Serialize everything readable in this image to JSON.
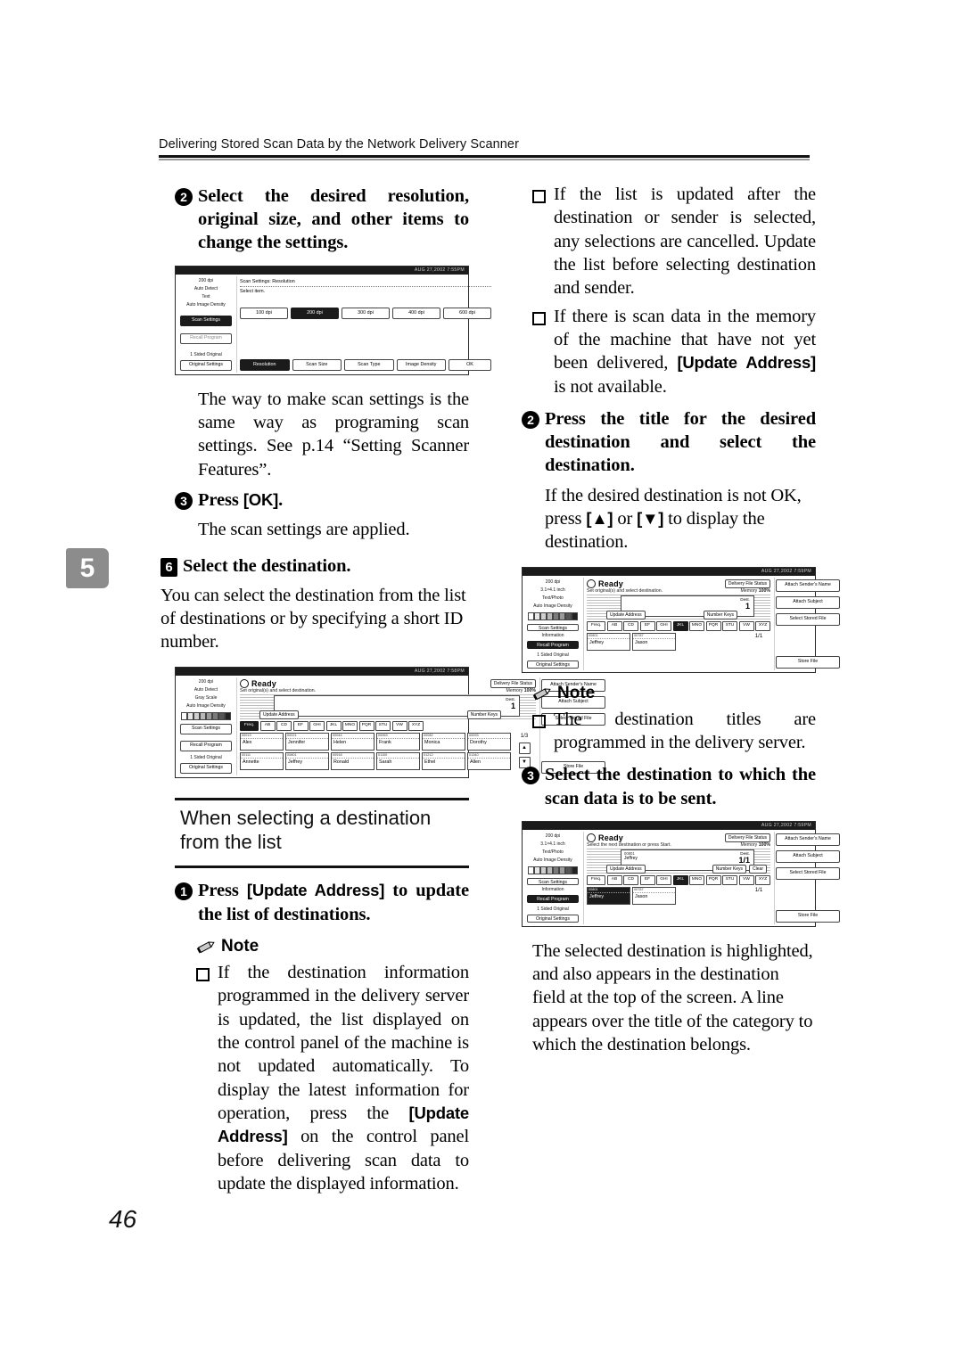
{
  "header": {
    "running_head": "Delivering Stored Scan Data by the Network Delivery Scanner"
  },
  "chapter_tab": "5",
  "folio": "46",
  "left_column": {
    "step2": {
      "num": "2",
      "text": "Select the desired resolution, original size, and other items to change the settings."
    },
    "para_scan_settings": "The way to make scan settings is the same way as programing scan settings. See p.14 “Setting Scanner Features”.",
    "step3": {
      "num": "3",
      "text_prefix": "Press ",
      "key": "[OK]",
      "text_suffix": "."
    },
    "para_applied": "The scan settings are applied.",
    "step6": {
      "num": "6",
      "text": "Select the destination."
    },
    "para_select_dest": "You can select the destination from the list of destinations or by specifying a short ID number.",
    "section_heading": "When selecting a destination from the list",
    "step1": {
      "num": "1",
      "text_prefix": "Press ",
      "key": "[Update Address]",
      "text_suffix": " to update the list of destinations."
    },
    "note_label": "Note",
    "note_bullet_1_part1": "If the destination information programmed in the delivery server is updated, the list displayed on the control panel of the machine is not updated automatically. To display the latest information for operation, press the ",
    "note_bullet_1_key": "[Update Address]",
    "note_bullet_1_part2": " on the control panel before delivering scan data to update the displayed information."
  },
  "right_column": {
    "note_bullet_1": "If the list is updated after the destination or sender is selected, any selections are cancelled. Update the list before selecting destination and sender.",
    "note_bullet_2_part1": "If there is scan data in the memory of the machine that have not yet been delivered, ",
    "note_bullet_2_key": "[Update Address]",
    "note_bullet_2_part2": " is not available.",
    "step2": {
      "num": "2",
      "text": "Press the title for the desired destination and select the destination."
    },
    "para_not_ok_part1": "If the desired destination is not OK, press ",
    "para_not_ok_key_up": "[▲]",
    "para_not_ok_mid": " or ",
    "para_not_ok_key_down": "[▼]",
    "para_not_ok_part2": " to display the destination.",
    "note_label": "Note",
    "note_bullet_3": "The destination titles are programmed in the delivery server.",
    "step3": {
      "num": "3",
      "text": "Select the destination to which the scan data is to be sent."
    },
    "para_highlighted": "The selected destination is highlighted, and also appears in the destination field at the top of the screen. A line appears over the title of the category to which the destination belongs."
  },
  "lcd_resolution": {
    "datetime": "AUG 27,2002 7:55PM",
    "sidebar": {
      "lines": [
        "200 dpi",
        "Auto Detect",
        "Text",
        "Auto Image Density"
      ],
      "scan_settings": "Scan Settings",
      "recall_program": "Recall Program",
      "sided": "1 Sided Original",
      "original_settings": "Original Settings"
    },
    "breadcrumb": "Scan Settings: Resolution",
    "prompt": "Select item.",
    "resolutions": [
      "100 dpi",
      "200 dpi",
      "300 dpi",
      "400 dpi",
      "600 dpi"
    ],
    "resolution_selected": "200 dpi",
    "bottom_tabs": [
      "Resolution",
      "Scan Size",
      "Scan Type",
      "Image Density"
    ],
    "bottom_tab_selected": "Resolution",
    "ok_label": "OK"
  },
  "lcd_list": {
    "datetime": "AUG 27,2002 7:58PM",
    "sidebar": {
      "lines": [
        "200 dpi",
        "Auto Detect",
        "Gray Scale",
        "Auto Image Density"
      ],
      "scan_settings": "Scan Settings",
      "recall_program": "Recall Program",
      "sided": "1 Sided Original",
      "original_settings": "Original Settings"
    },
    "status": "Ready",
    "subtitle": "Set original(s) and select destination.",
    "delivery_file_status": "Delivery File Status",
    "memory_label": "Memory",
    "memory_value": "100%",
    "dest_label": "Dest.",
    "dest_count": "1",
    "update_address": "Update Address",
    "number_keys": "Number Keys",
    "tabs": [
      "Freq.",
      "AB",
      "CD",
      "EF",
      "GHI",
      "JKL",
      "MNO",
      "PQR",
      "STU",
      "VW",
      "XYZ"
    ],
    "tab_selected": "Freq.",
    "page_indicator": "1/3",
    "entries_row1": [
      {
        "code": "00013",
        "name": "Alex"
      },
      {
        "code": "00021",
        "name": "Jennifer"
      },
      {
        "code": "00044",
        "name": "Helen"
      },
      {
        "code": "00063",
        "name": "Frank"
      },
      {
        "code": "00082",
        "name": "Monica"
      },
      {
        "code": "00093",
        "name": "Dorothy"
      }
    ],
    "entries_row2": [
      {
        "code": "00111",
        "name": "Annette"
      },
      {
        "code": "00801",
        "name": "Jeffrey"
      },
      {
        "code": "00918",
        "name": "Ronald"
      },
      {
        "code": "01100",
        "name": "Sarah"
      },
      {
        "code": "01212",
        "name": "Ethel"
      },
      {
        "code": "01340",
        "name": "Allen"
      }
    ],
    "right_buttons": [
      "Attach Sender's Name",
      "Attach Subject",
      "Select Stored File",
      "Store File"
    ]
  },
  "lcd_title": {
    "datetime": "AUG 27,2002 7:59PM",
    "sidebar": {
      "lines": [
        "200 dpi",
        "3.1×4.1 inch",
        "Text/Photo",
        "Auto Image Density"
      ],
      "scan_settings": "Scan Settings",
      "information": "Information",
      "recall_program": "Recall Program",
      "sided": "1 Sided Original",
      "original_settings": "Original Settings"
    },
    "status": "Ready",
    "subtitle": "Set original(s) and select destination.",
    "delivery_file_status": "Delivery File Status",
    "memory_label": "Memory",
    "memory_value": "100%",
    "dest_label": "Dest.",
    "dest_count": "1",
    "update_address": "Update Address",
    "number_keys": "Number Keys",
    "tabs": [
      "Freq.",
      "AB",
      "CD",
      "EF",
      "GHI",
      "JKL",
      "MNO",
      "PQR",
      "STU",
      "VW",
      "XYZ"
    ],
    "tab_selected": "JKL",
    "page_indicator": "1/1",
    "entries_row1": [
      {
        "code": "00801",
        "name": "Jeffrey"
      },
      {
        "code": "00787",
        "name": "Jason"
      }
    ],
    "right_buttons": [
      "Attach Sender's Name",
      "Attach Subject",
      "Select Stored File",
      "Store File"
    ]
  },
  "lcd_selected": {
    "datetime": "AUG 27,2002 7:59PM",
    "sidebar": {
      "lines": [
        "200 dpi",
        "3.1×4.1 inch",
        "Text/Photo",
        "Auto Image Density"
      ],
      "scan_settings": "Scan Settings",
      "information": "Information",
      "recall_program": "Recall Program",
      "sided": "1 Sided Original",
      "original_settings": "Original Settings"
    },
    "status": "Ready",
    "subtitle": "Select the next destination or press Start.",
    "delivery_file_status": "Delivery File Status",
    "memory_label": "Memory",
    "memory_value": "100%",
    "dest_label": "Dest.",
    "dest_count": "1/1",
    "dest_entry_code": "00801",
    "dest_entry_name": "Jeffrey",
    "update_address": "Update Address",
    "number_keys": "Number Keys",
    "clear_label": "Clear",
    "tabs": [
      "Freq.",
      "AB",
      "CD",
      "EF",
      "GHI",
      "JKL",
      "MNO",
      "PQR",
      "STU",
      "VW",
      "XYZ"
    ],
    "tab_selected": "JKL",
    "page_indicator": "1/1",
    "entries_row1": [
      {
        "code": "00801",
        "name": "Jeffrey",
        "selected": true
      },
      {
        "code": "00787",
        "name": "Jason",
        "selected": false
      }
    ],
    "right_buttons": [
      "Attach Sender's Name",
      "Attach Subject",
      "Select Stored File",
      "Store File"
    ]
  }
}
